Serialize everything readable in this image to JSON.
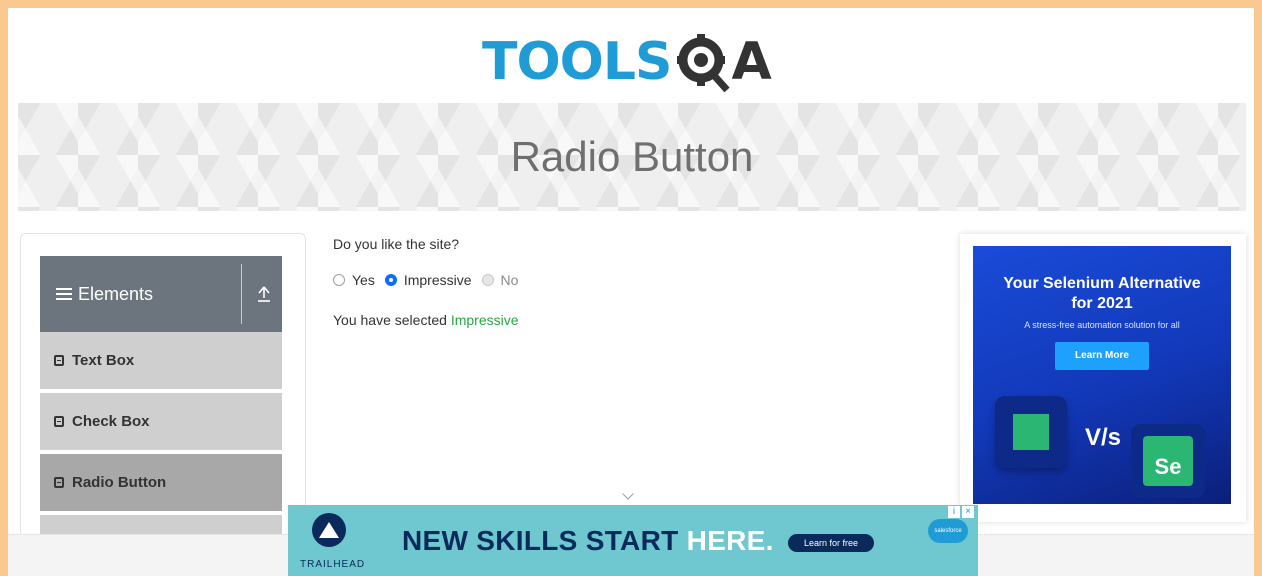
{
  "header": {
    "logo_main": "TOOLS",
    "logo_end": "A"
  },
  "banner": {
    "title": "Radio Button"
  },
  "sidebar": {
    "group_label": "Elements",
    "items": [
      {
        "label": "Text Box"
      },
      {
        "label": "Check Box"
      },
      {
        "label": "Radio Button"
      }
    ]
  },
  "main": {
    "question": "Do you like the site?",
    "options": [
      {
        "label": "Yes",
        "state": "unchecked"
      },
      {
        "label": "Impressive",
        "state": "checked"
      },
      {
        "label": "No",
        "state": "disabled"
      }
    ],
    "result_prefix": "You have selected",
    "result_value": "Impressive"
  },
  "right_ad": {
    "headline_1": "Your Selenium Alternative",
    "headline_2": "for 2021",
    "subtext": "A stress-free automation solution for all",
    "cta": "Learn More",
    "vs": "V/s",
    "tile_right": "Se"
  },
  "bottom_ad": {
    "brand": "TRAILHEAD",
    "headline_main": "NEW SKILLS START",
    "headline_accent": "HERE.",
    "cta": "Learn for free",
    "partner": "salesforce"
  },
  "colors": {
    "accent_blue": "#1f9bd6",
    "selected_green": "#28a745",
    "sidebar_header": "#6c757d",
    "outer_border": "#f9c98f"
  }
}
